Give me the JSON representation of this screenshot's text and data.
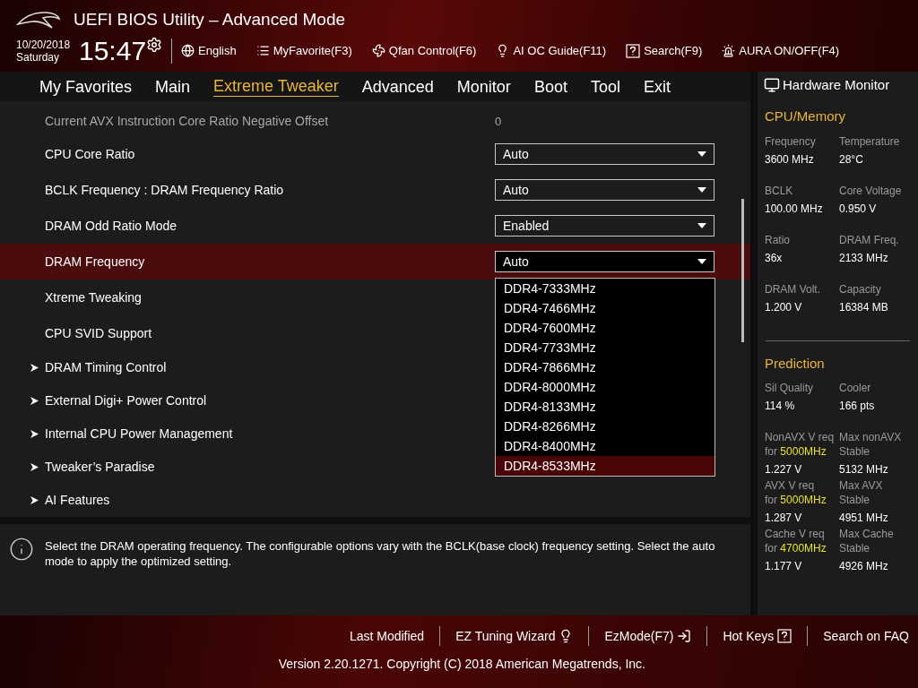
{
  "header": {
    "title": "UEFI BIOS Utility – Advanced Mode",
    "date": "10/20/2018",
    "day": "Saturday",
    "time": "15:47",
    "toolbar": [
      {
        "label": "English"
      },
      {
        "label": "MyFavorite(F3)"
      },
      {
        "label": "Qfan Control(F6)"
      },
      {
        "label": "AI OC Guide(F11)"
      },
      {
        "label": "Search(F9)"
      },
      {
        "label": "AURA ON/OFF(F4)"
      }
    ]
  },
  "tabs": [
    {
      "label": "My Favorites",
      "selected": false
    },
    {
      "label": "Main",
      "selected": false
    },
    {
      "label": "Extreme Tweaker",
      "selected": true
    },
    {
      "label": "Advanced",
      "selected": false
    },
    {
      "label": "Monitor",
      "selected": false
    },
    {
      "label": "Boot",
      "selected": false
    },
    {
      "label": "Tool",
      "selected": false
    },
    {
      "label": "Exit",
      "selected": false
    }
  ],
  "settings": [
    {
      "kind": "info",
      "label": "Current AVX Instruction Core Ratio Negative Offset",
      "value": "0",
      "selected": false
    },
    {
      "kind": "dropdown",
      "label": "CPU Core Ratio",
      "value": "Auto",
      "selected": false
    },
    {
      "kind": "dropdown",
      "label": "BCLK Frequency : DRAM Frequency Ratio",
      "value": "Auto",
      "selected": false
    },
    {
      "kind": "dropdown",
      "label": "DRAM Odd Ratio Mode",
      "value": "Enabled",
      "selected": false
    },
    {
      "kind": "dropdown",
      "label": "DRAM Frequency",
      "value": "Auto",
      "selected": true
    },
    {
      "kind": "plain",
      "label": "Xtreme Tweaking",
      "selected": false
    },
    {
      "kind": "plain",
      "label": "CPU SVID Support",
      "selected": false
    },
    {
      "kind": "submenu",
      "label": "DRAM Timing Control",
      "selected": false
    },
    {
      "kind": "submenu",
      "label": "External Digi+ Power Control",
      "selected": false
    },
    {
      "kind": "submenu",
      "label": "Internal CPU Power Management",
      "selected": false
    },
    {
      "kind": "submenu",
      "label": "Tweaker’s Paradise",
      "selected": false
    },
    {
      "kind": "submenu",
      "label": "AI Features",
      "selected": false
    }
  ],
  "dropdown_options": [
    {
      "label": "DDR4-7333MHz",
      "selected": false
    },
    {
      "label": "DDR4-7466MHz",
      "selected": false
    },
    {
      "label": "DDR4-7600MHz",
      "selected": false
    },
    {
      "label": "DDR4-7733MHz",
      "selected": false
    },
    {
      "label": "DDR4-7866MHz",
      "selected": false
    },
    {
      "label": "DDR4-8000MHz",
      "selected": false
    },
    {
      "label": "DDR4-8133MHz",
      "selected": false
    },
    {
      "label": "DDR4-8266MHz",
      "selected": false
    },
    {
      "label": "DDR4-8400MHz",
      "selected": false
    },
    {
      "label": "DDR4-8533MHz",
      "selected": true
    }
  ],
  "help_text": "Select the DRAM operating frequency. The configurable options vary with the BCLK(base clock) frequency setting. Select the auto mode to apply the optimized setting.",
  "hardware_monitor": {
    "title": "Hardware Monitor",
    "sections": [
      {
        "title": "CPU/Memory",
        "items": [
          {
            "label": "Frequency",
            "value": "3600 MHz"
          },
          {
            "label": "Temperature",
            "value": "28°C"
          },
          {
            "label": "BCLK",
            "value": "100.00 MHz"
          },
          {
            "label": "Core Voltage",
            "value": "0.950 V"
          },
          {
            "label": "Ratio",
            "value": "36x"
          },
          {
            "label": "DRAM Freq.",
            "value": "2133 MHz"
          },
          {
            "label": "DRAM Volt.",
            "value": "1.200 V"
          },
          {
            "label": "Capacity",
            "value": "16384 MB"
          }
        ]
      },
      {
        "title": "Prediction",
        "items": [
          {
            "label": "Sil Quality",
            "value": "114 %"
          },
          {
            "label": "Cooler",
            "value": "166 pts"
          },
          {
            "label": "NonAVX V req",
            "sub_prefix": "for",
            "sub_highlight": "5000MHz",
            "value": "1.227 V"
          },
          {
            "label": "Max nonAVX",
            "sub": "Stable",
            "value": "5132 MHz"
          },
          {
            "label": "AVX V req",
            "sub_prefix": "for",
            "sub_highlight": "5000MHz",
            "value": "1.287 V"
          },
          {
            "label": "Max AVX",
            "sub": "Stable",
            "value": "4951 MHz"
          },
          {
            "label": "Cache V req",
            "sub_prefix": "for",
            "sub_highlight": "4700MHz",
            "value": "1.177 V"
          },
          {
            "label": "Max Cache",
            "sub": "Stable",
            "value": "4926 MHz"
          }
        ]
      }
    ]
  },
  "footer": {
    "links": [
      {
        "label": "Last Modified"
      },
      {
        "label": "EZ Tuning Wizard"
      },
      {
        "label": "EzMode(F7)"
      },
      {
        "label": "Hot Keys"
      },
      {
        "label": "Search on FAQ"
      }
    ],
    "version": "Version 2.20.1271. Copyright (C) 2018 American Megatrends, Inc."
  }
}
